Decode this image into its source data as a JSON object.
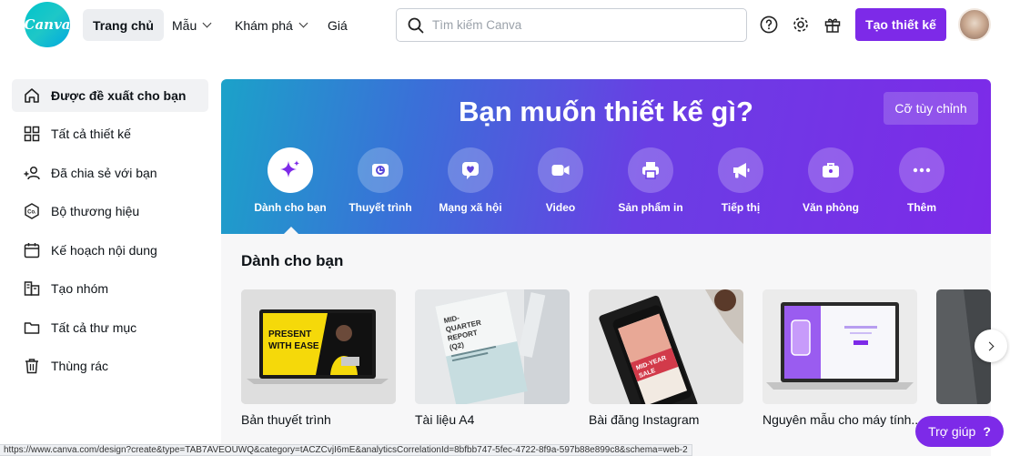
{
  "header": {
    "logo_text": "Canva",
    "nav": [
      {
        "label": "Trang chủ",
        "active": true
      },
      {
        "label": "Mẫu",
        "dropdown": true
      },
      {
        "label": "Khám phá",
        "dropdown": true
      },
      {
        "label": "Giá"
      }
    ],
    "search_placeholder": "Tìm kiếm Canva",
    "create_label": "Tạo thiết kế"
  },
  "sidebar": {
    "items": [
      {
        "label": "Được đề xuất cho bạn",
        "icon": "home-icon"
      },
      {
        "label": "Tất cả thiết kế",
        "icon": "grid-icon"
      },
      {
        "label": "Đã chia sẻ với bạn",
        "icon": "shared-users-icon"
      },
      {
        "label": "Bộ thương hiệu",
        "icon": "brand-kit-icon"
      },
      {
        "label": "Kế hoạch nội dung",
        "icon": "calendar-icon"
      },
      {
        "label": "Tạo nhóm",
        "icon": "team-icon"
      },
      {
        "label": "Tất cả thư mục",
        "icon": "folder-icon"
      },
      {
        "label": "Thùng rác",
        "icon": "trash-icon"
      }
    ]
  },
  "hero": {
    "title": "Bạn muốn thiết kế gì?",
    "custom_label": "Cỡ tùy chỉnh",
    "categories": [
      {
        "label": "Dành cho bạn",
        "icon": "sparkle-icon"
      },
      {
        "label": "Thuyết trình",
        "icon": "presentation-icon"
      },
      {
        "label": "Mạng xã hội",
        "icon": "heart-chat-icon"
      },
      {
        "label": "Video",
        "icon": "video-camera-icon"
      },
      {
        "label": "Sản phẩm in",
        "icon": "printer-icon"
      },
      {
        "label": "Tiếp thị",
        "icon": "megaphone-icon"
      },
      {
        "label": "Văn phòng",
        "icon": "briefcase-icon"
      },
      {
        "label": "Thêm",
        "icon": "more-dots-icon"
      }
    ]
  },
  "section": {
    "title": "Dành cho bạn",
    "cards": [
      {
        "label": "Bản thuyết trình",
        "thumb_text": [
          "PRESENT",
          "WITH EASE"
        ]
      },
      {
        "label": "Tài liệu A4",
        "thumb_text": [
          "MID-",
          "QUARTER",
          "REPORT",
          "(Q2)"
        ]
      },
      {
        "label": "Bài đăng Instagram",
        "thumb_text": [
          "MID-YEAR",
          "SALE"
        ]
      },
      {
        "label": "Nguyên mẫu cho máy tính..."
      }
    ]
  },
  "help_label": "Trợ giúp",
  "status_url": "https://www.canva.com/design?create&type=TAB7AVEOUWQ&category=tACZCvjI6mE&analyticsCorrelationId=8bfbb747-5fec-4722-8f9a-597b88e899c8&schema=web-2",
  "colors": {
    "brand": "#7d2ae8",
    "logo": "#00c4cc"
  }
}
